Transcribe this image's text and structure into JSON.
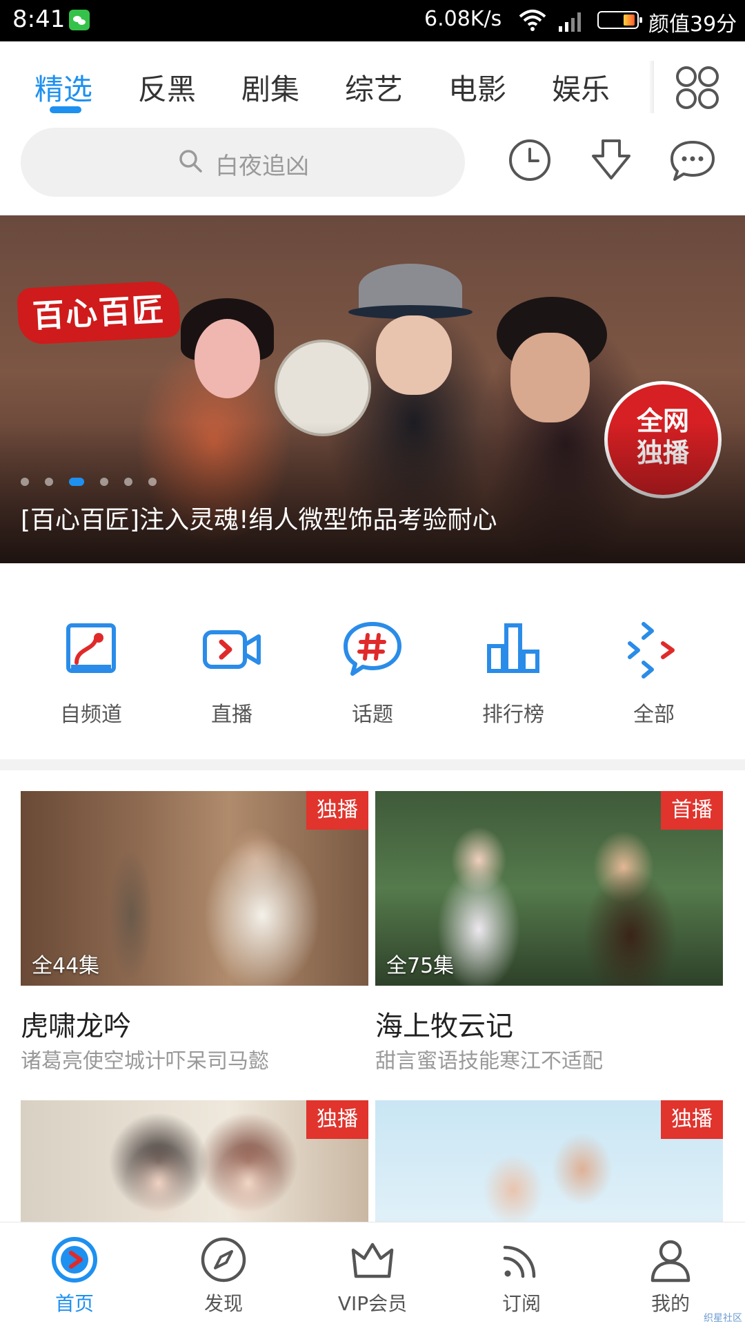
{
  "status_bar": {
    "time": "8:41",
    "speed": "6.08K/s",
    "score": "颜值39分"
  },
  "top_tabs": [
    "精选",
    "反黑",
    "剧集",
    "综艺",
    "电影",
    "娱乐"
  ],
  "search": {
    "placeholder": "白夜追凶"
  },
  "banner": {
    "logo": "百心百匠",
    "badge_line1": "全网",
    "badge_line2": "独播",
    "caption": "[百心百匠]注入灵魂!绢人微型饰品考验耐心",
    "slide_index": 3,
    "slide_count": 6
  },
  "shortcuts": [
    "自频道",
    "直播",
    "话题",
    "排行榜",
    "全部"
  ],
  "cards": [
    {
      "badge": "独播",
      "episodes": "全44集",
      "title": "虎啸龙吟",
      "subtitle": "诸葛亮使空城计吓呆司马懿"
    },
    {
      "badge": "首播",
      "episodes": "全75集",
      "title": "海上牧云记",
      "subtitle": "甜言蜜语技能寒江不适配"
    },
    {
      "badge": "独播"
    },
    {
      "badge": "独播"
    }
  ],
  "bottom_nav": [
    "首页",
    "发现",
    "VIP会员",
    "订阅",
    "我的"
  ],
  "watermark": "织星社区",
  "colors": {
    "accent": "#1e90f0",
    "badge": "#e0342d",
    "shortcut_red": "#e02a2a"
  }
}
